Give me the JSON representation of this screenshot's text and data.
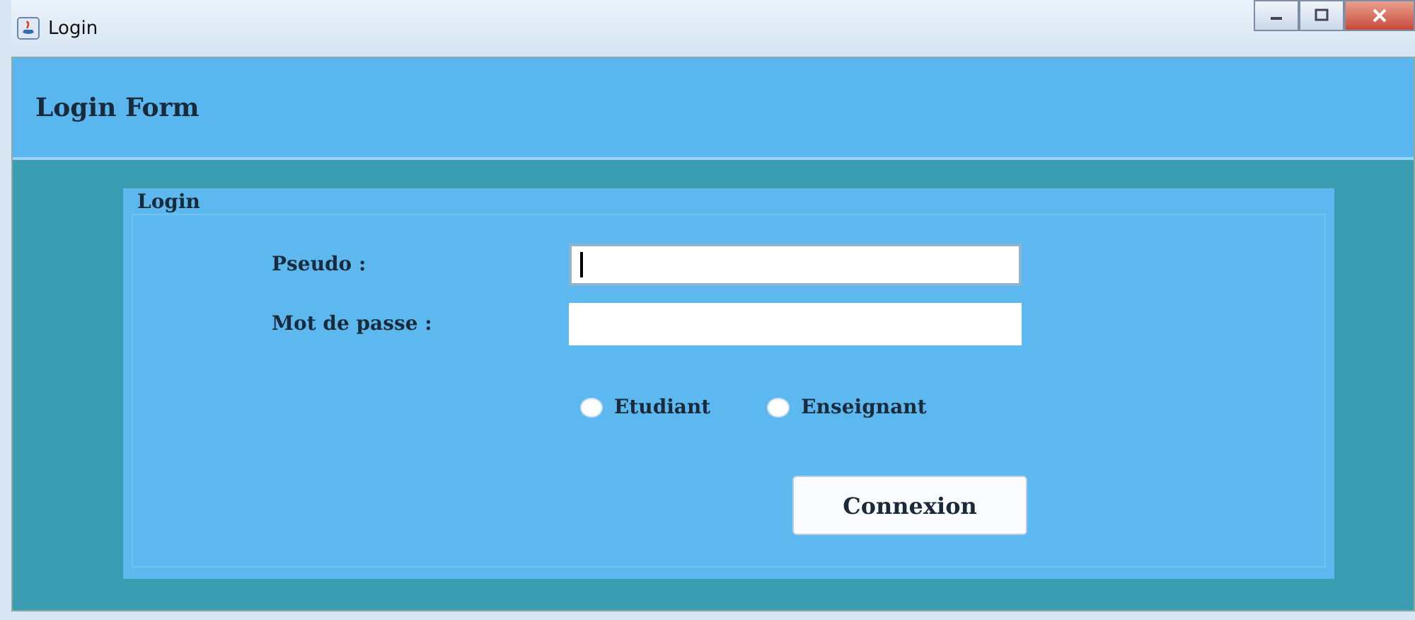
{
  "window": {
    "title": "Login"
  },
  "header": {
    "title": "Login Form"
  },
  "panel": {
    "title": "Login",
    "fields": [
      {
        "label": "Pseudo :",
        "focused": true
      },
      {
        "label": "Mot de passe :",
        "focused": false
      }
    ],
    "roles": [
      {
        "label": "Etudiant",
        "selected": false
      },
      {
        "label": "Enseignant",
        "selected": false
      }
    ],
    "button": "Connexion"
  }
}
